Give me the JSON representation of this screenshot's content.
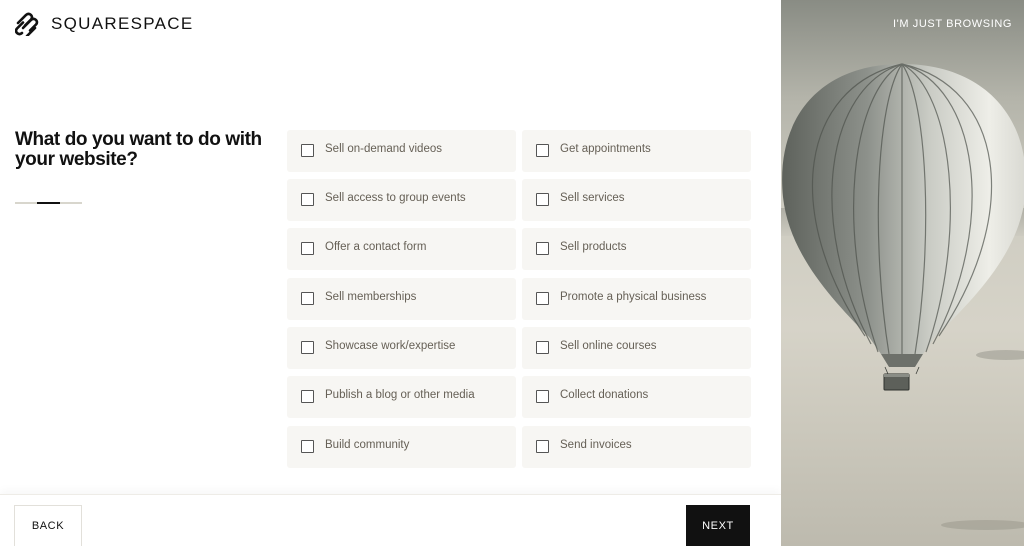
{
  "header": {
    "logo_text": "SQUARESPACE",
    "logo_icon": "squarespace-logo-icon",
    "browse_link": "I'M JUST BROWSING"
  },
  "question": {
    "title": "What do you want to do with your website?",
    "progress": {
      "step": 2,
      "total": 3
    }
  },
  "options": {
    "left": [
      {
        "label": "Sell on-demand videos",
        "checked": false
      },
      {
        "label": "Sell access to group events",
        "checked": false
      },
      {
        "label": "Offer a contact form",
        "checked": false
      },
      {
        "label": "Sell memberships",
        "checked": false
      },
      {
        "label": "Showcase work/expertise",
        "checked": false
      },
      {
        "label": "Publish a blog or other media",
        "checked": false
      },
      {
        "label": "Build community",
        "checked": false
      }
    ],
    "right": [
      {
        "label": "Get appointments",
        "checked": false
      },
      {
        "label": "Sell services",
        "checked": false
      },
      {
        "label": "Sell products",
        "checked": false
      },
      {
        "label": "Promote a physical business",
        "checked": false
      },
      {
        "label": "Sell online courses",
        "checked": false
      },
      {
        "label": "Collect donations",
        "checked": false
      },
      {
        "label": "Send invoices",
        "checked": false
      }
    ]
  },
  "footer": {
    "back_label": "BACK",
    "next_label": "NEXT"
  },
  "colors": {
    "accent": "#111111",
    "option_bg": "#f7f6f3",
    "label_text": "#666056"
  }
}
